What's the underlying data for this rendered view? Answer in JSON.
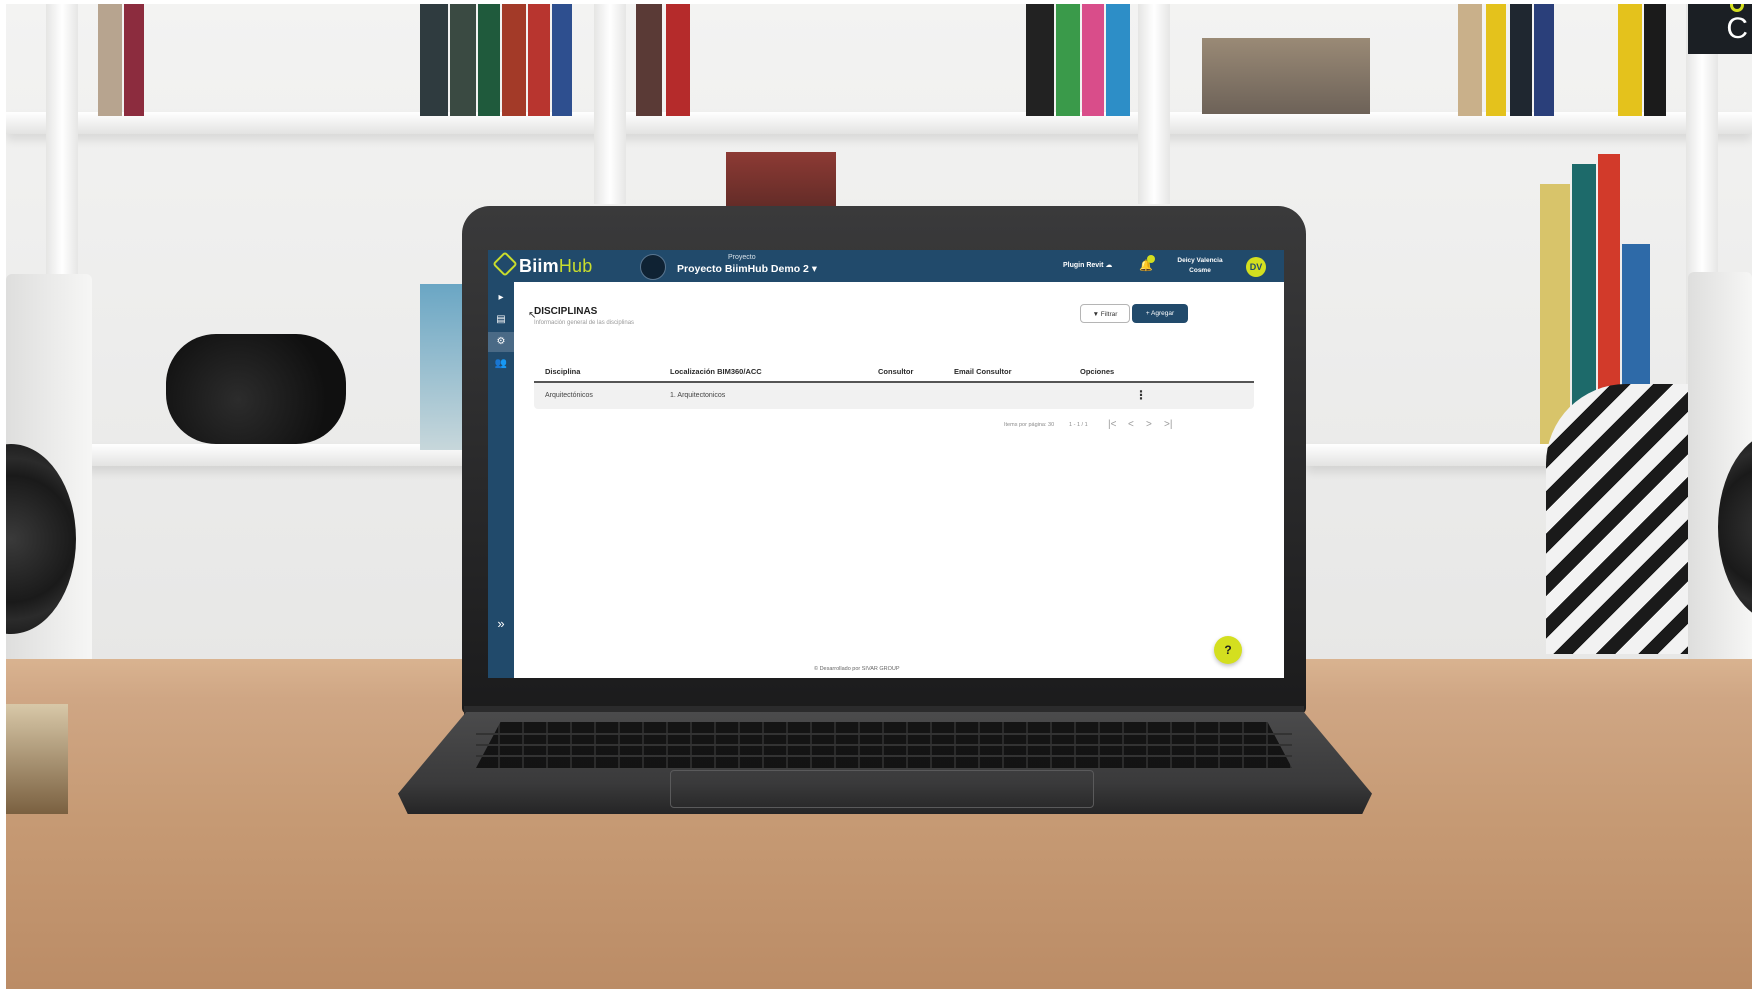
{
  "app": {
    "brand_biim": "Biim",
    "brand_hub": "Hub",
    "project_caption": "Proyecto",
    "project_name": "Proyecto BiimHub Demo 2 ▾",
    "plugin_label": "Plugin Revit ☁",
    "user_name_line1": "Deicy Valencia",
    "user_name_line2": "Cosme",
    "user_initials": "DV"
  },
  "sidebar": {
    "items": [
      {
        "icon": "chevron-right-icon",
        "glyph": "▸"
      },
      {
        "icon": "document-icon",
        "glyph": "▤"
      },
      {
        "icon": "gear-icon",
        "glyph": "⚙"
      },
      {
        "icon": "users-icon",
        "glyph": "👥"
      },
      {
        "icon": "expand-icon",
        "glyph": "»"
      }
    ]
  },
  "page": {
    "title": "DISCIPLINAS",
    "subtitle": "Información general de las disciplinas",
    "filter_label": "▼ Filtrar",
    "add_label": "+ Agregar"
  },
  "table": {
    "columns": [
      "Disciplina",
      "Localización BIM360/ACC",
      "Consultor",
      "Email Consultor",
      "Opciones"
    ],
    "rows": [
      {
        "disciplina": "Arquitectónicos",
        "localizacion": "1. Arquitectonicos",
        "consultor": "",
        "email": "",
        "opciones": "⋮"
      }
    ]
  },
  "pagination": {
    "items_per_page": "Items por página: 30",
    "range": "1 - 1 / 1",
    "first": "|<",
    "prev": "<",
    "next": ">",
    "last": ">|"
  },
  "help_label": "?",
  "footer": "© Desarrollado por SIVAR GROUP",
  "colors": {
    "primary": "#214a6b",
    "accent": "#d4df1f",
    "row_bg": "#f1f1f1"
  }
}
